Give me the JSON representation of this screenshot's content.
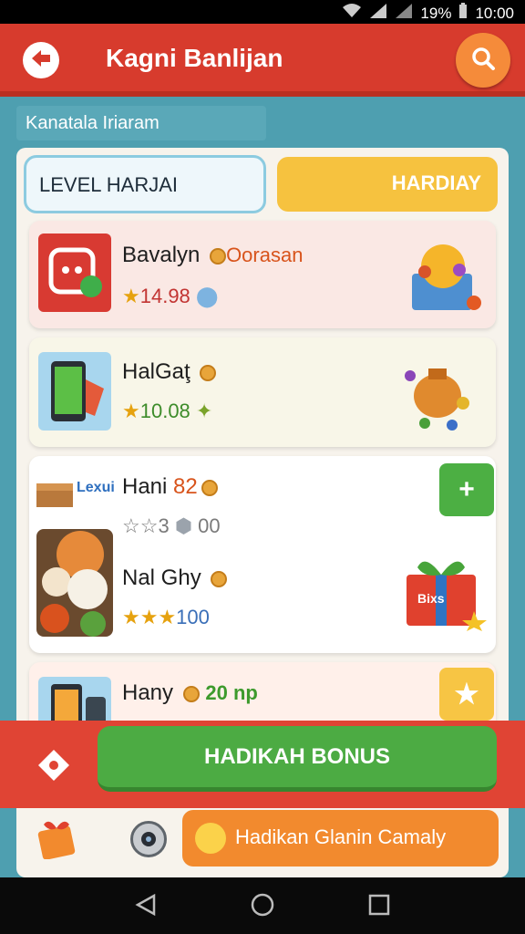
{
  "status_bar": {
    "battery": "19%",
    "time": "10:00"
  },
  "app_bar": {
    "title": "Kagni Banlijan"
  },
  "subtitle": "Kanatala Iriaram",
  "tabs": {
    "level_label": "LEVEL HARJAI",
    "hardiay_label": "HARDIAY"
  },
  "items": [
    {
      "name": "Bavalyn",
      "tag": "Oorasan",
      "value": "14.98"
    },
    {
      "name": "HalGaţ",
      "value": "10.08"
    },
    {
      "name": "Hani",
      "badge": "82",
      "value_a": "3",
      "value_b": "00",
      "box_label": "Lexui"
    },
    {
      "name": "Nal Ghy",
      "value": "100",
      "gift_label": "Bixs"
    },
    {
      "name": "Hany",
      "badge": "20 np"
    }
  ],
  "bonus": {
    "label": "HADIKAH BONUS"
  },
  "footer": {
    "button_label": "Hadikan Glanin Camaly"
  },
  "colors": {
    "app_bar": "#d73b2d",
    "search": "#f58b3a",
    "tab_hardiay": "#f6c23f",
    "bonus": "#4cab43",
    "bar": "#e04434",
    "footer_btn": "#f28a2e",
    "background": "#4e9fb0"
  }
}
